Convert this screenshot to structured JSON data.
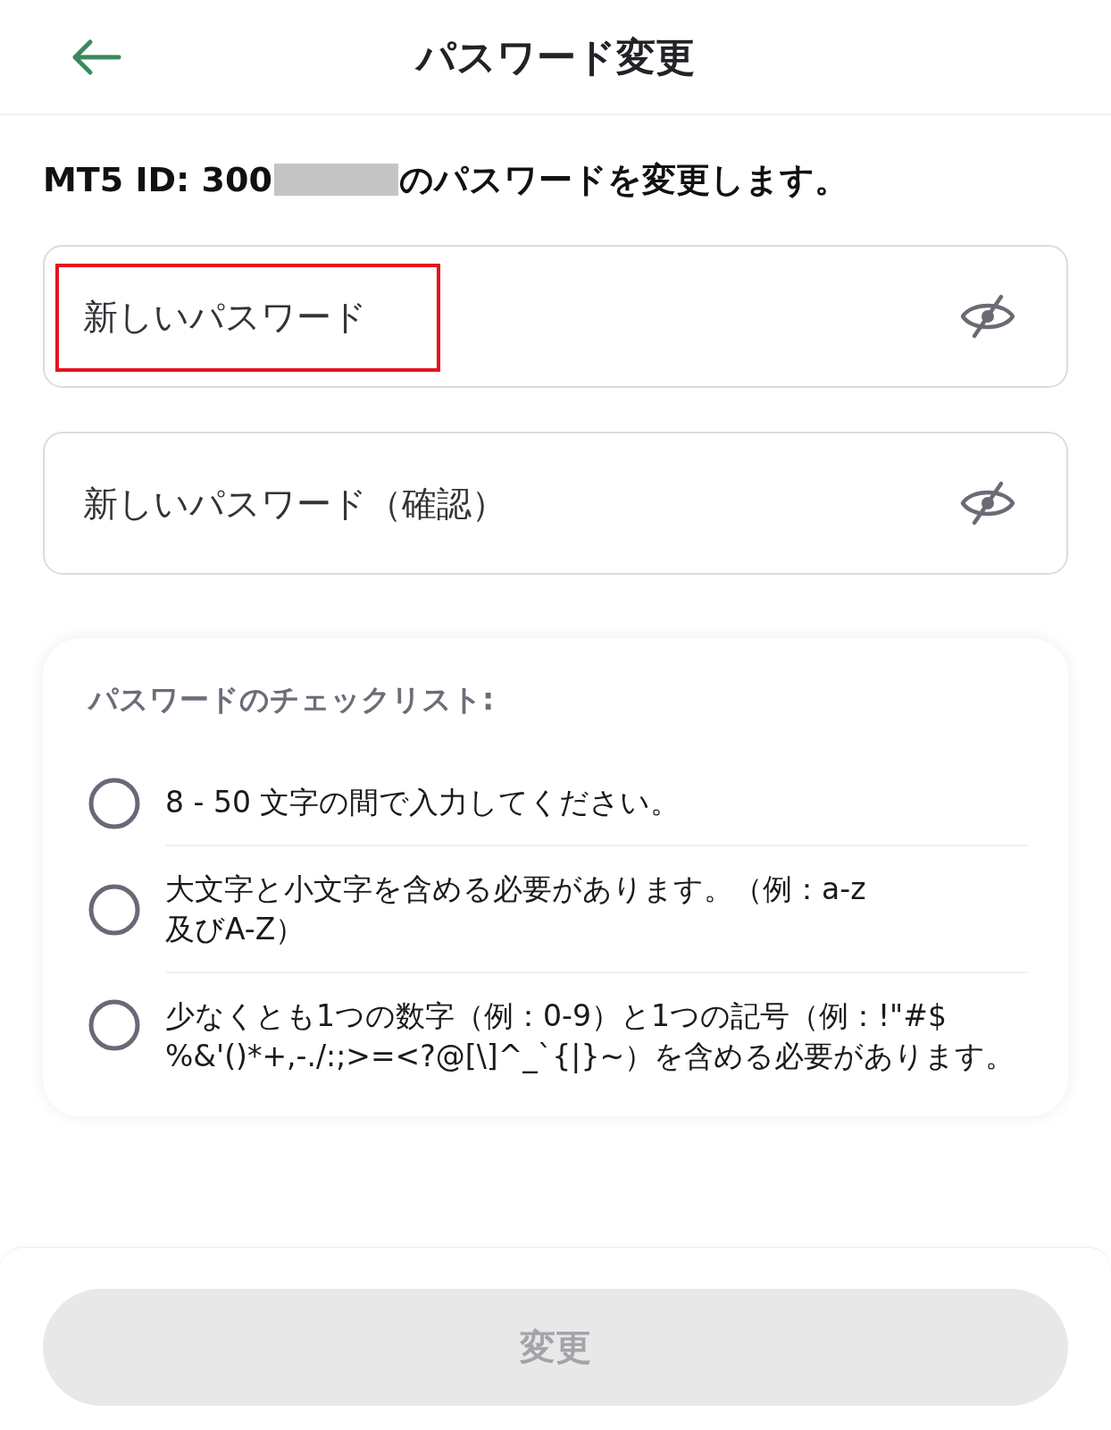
{
  "header": {
    "title": "パスワード変更"
  },
  "intro": {
    "id_text": "MT5 ID: 300",
    "redacted": true,
    "text": "のパスワードを変更します。"
  },
  "fields": [
    {
      "placeholder": "新しいパスワード",
      "visible": false,
      "highlighted": true
    },
    {
      "placeholder": "新しいパスワード（確認）",
      "visible": false,
      "highlighted": false
    }
  ],
  "checklist": {
    "title": "パスワードのチェックリスト:",
    "items": [
      {
        "text": "8 - 50 文字の間で入力してください。",
        "checked": false
      },
      {
        "text": "大文字と小文字を含める必要があります。（例：a-z\n及びA-Z）",
        "checked": false
      },
      {
        "text": "少なくとも1つの数字（例：0-9）と1つの記号（例：!\"#$\n%&'()*+,-./:;>=<?@[\\]^_`{|}~）を含める必要があります。",
        "checked": false
      }
    ]
  },
  "submit_button": {
    "label": "変更",
    "disabled": true
  }
}
